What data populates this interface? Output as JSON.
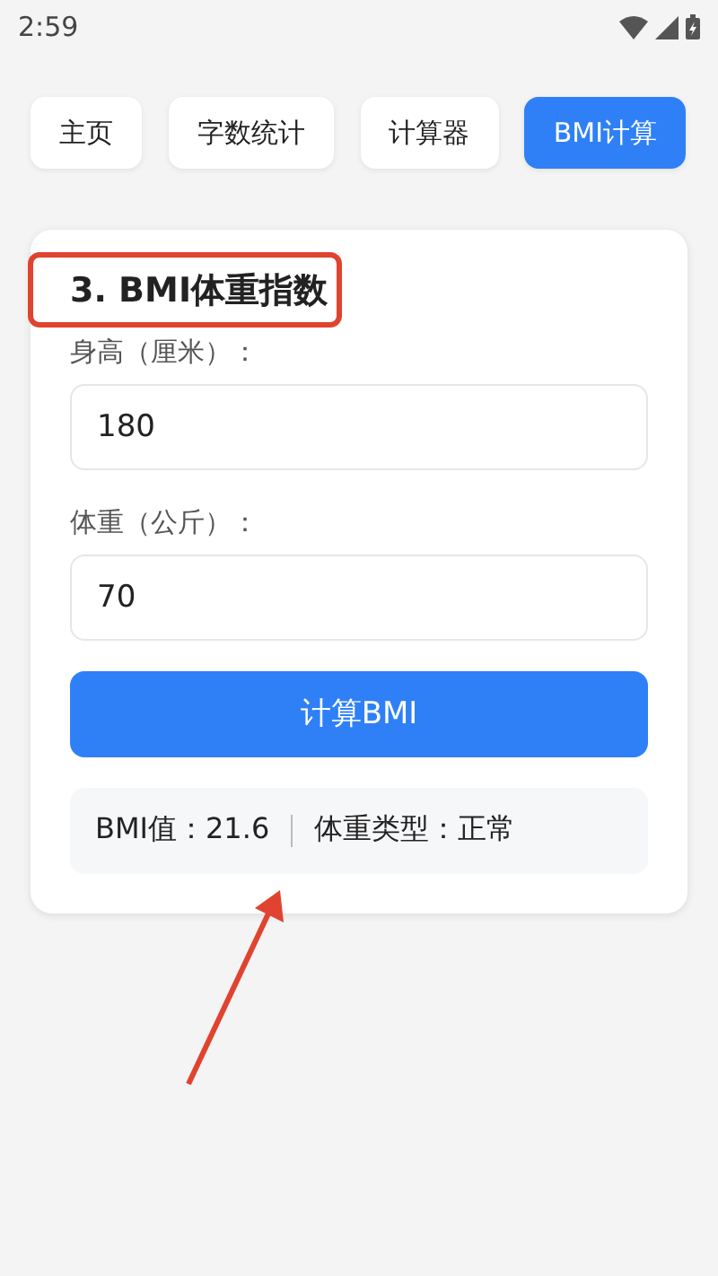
{
  "status_bar": {
    "time": "2:59"
  },
  "tabs": [
    {
      "label": "主页",
      "selected": false
    },
    {
      "label": "字数统计",
      "selected": false
    },
    {
      "label": "计算器",
      "selected": false
    },
    {
      "label": "BMI计算",
      "selected": true
    }
  ],
  "card": {
    "title": "3. BMI体重指数",
    "fields": [
      {
        "label": "身高（厘米）：",
        "value": "180"
      },
      {
        "label": "体重（公斤）：",
        "value": "70"
      }
    ],
    "button": "计算BMI",
    "result": {
      "bmi": "BMI值：21.6",
      "type": "体重类型：正常"
    }
  }
}
